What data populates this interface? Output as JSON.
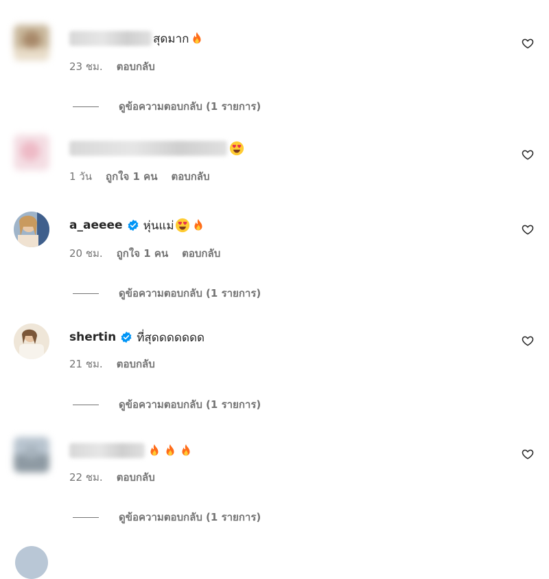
{
  "comments": [
    {
      "username": "",
      "text": "สุดมาก",
      "emojis": [
        "fire"
      ],
      "time": "23 ชม.",
      "likes": "",
      "reply_label": "ตอบกลับ",
      "view_replies": "ดูข้อความตอบกลับ (1 รายการ)"
    },
    {
      "username": "",
      "text": "",
      "emojis": [
        "heart-eyes"
      ],
      "time": "1 วัน",
      "likes": "ถูกใจ 1 คน",
      "reply_label": "ตอบกลับ",
      "view_replies": ""
    },
    {
      "username": "a_aeeee",
      "text": "หุ่นแม่",
      "emojis": [
        "heart-eyes",
        "fire"
      ],
      "time": "20 ชม.",
      "likes": "ถูกใจ 1 คน",
      "reply_label": "ตอบกลับ",
      "view_replies": "ดูข้อความตอบกลับ (1 รายการ)"
    },
    {
      "username": "shertin",
      "text": "ที่สุดดดดดดด",
      "emojis": [],
      "time": "21 ชม.",
      "likes": "",
      "reply_label": "ตอบกลับ",
      "view_replies": "ดูข้อความตอบกลับ (1 รายการ)"
    },
    {
      "username": "",
      "text": "",
      "emojis": [
        "fire",
        "fire",
        "fire"
      ],
      "time": "22 ชม.",
      "likes": "",
      "reply_label": "ตอบกลับ",
      "view_replies": "ดูข้อความตอบกลับ (1 รายการ)"
    }
  ],
  "colors": {
    "verified": "#0095f6",
    "text": "#262626",
    "secondary": "#737373"
  },
  "icons": {
    "like": "heart-outline-icon",
    "verified": "verified-badge-icon"
  }
}
